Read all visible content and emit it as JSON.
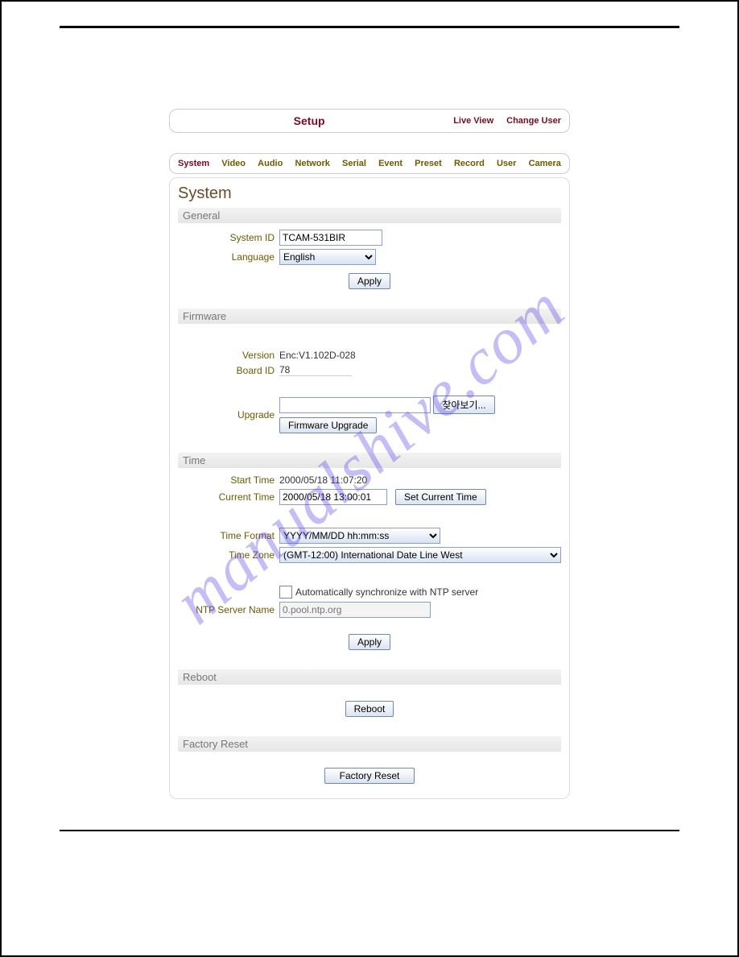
{
  "topbar": {
    "title": "Setup",
    "live_view": "Live View",
    "change_user": "Change User"
  },
  "tabs": {
    "system": "System",
    "video": "Video",
    "audio": "Audio",
    "network": "Network",
    "serial": "Serial",
    "event": "Event",
    "preset": "Preset",
    "record": "Record",
    "user": "User",
    "camera": "Camera"
  },
  "page_title": "System",
  "general": {
    "heading": "General",
    "system_id_label": "System ID",
    "system_id_value": "TCAM-531BIR",
    "language_label": "Language",
    "language_value": "English",
    "apply": "Apply"
  },
  "firmware": {
    "heading": "Firmware",
    "version_label": "Version",
    "version_value": "Enc:V1.102D-028",
    "board_id_label": "Board ID",
    "board_id_value": "78",
    "upgrade_label": "Upgrade",
    "browse_btn": "찾아보기...",
    "firmware_upgrade_btn": "Firmware Upgrade"
  },
  "time": {
    "heading": "Time",
    "start_time_label": "Start Time",
    "start_time_value": "2000/05/18 11:07:20",
    "current_time_label": "Current Time",
    "current_time_value": "2000/05/18 13:00:01",
    "set_current_time_btn": "Set Current Time",
    "time_format_label": "Time Format",
    "time_format_value": "YYYY/MM/DD hh:mm:ss",
    "time_zone_label": "Time Zone",
    "time_zone_value": "(GMT-12:00) International Date Line West",
    "ntp_sync_label": "Automatically synchronize with NTP server",
    "ntp_server_label": "NTP Server Name",
    "ntp_server_placeholder": "0.pool.ntp.org",
    "apply": "Apply"
  },
  "reboot": {
    "heading": "Reboot",
    "btn": "Reboot"
  },
  "factory_reset": {
    "heading": "Factory Reset",
    "btn": "Factory Reset"
  },
  "watermark": "manualshive.com"
}
